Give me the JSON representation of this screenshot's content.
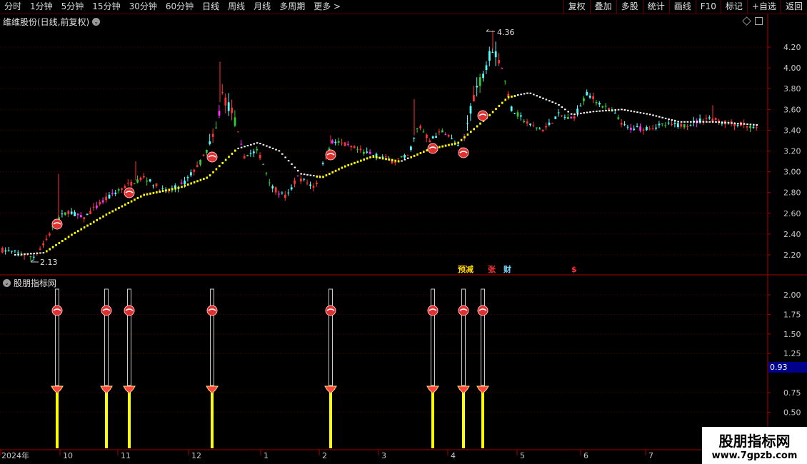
{
  "toolbar": {
    "tabs": [
      "分时",
      "1分钟",
      "5分钟",
      "15分钟",
      "30分钟",
      "60分钟",
      "日线",
      "周线",
      "月线",
      "多周期"
    ],
    "active_tab": "日线",
    "more_label": "更多 >",
    "right_buttons": [
      "复权",
      "叠加",
      "多股",
      "统计",
      "画线",
      "F10",
      "标记",
      "+自选",
      "返回"
    ]
  },
  "stock": {
    "title": "维维股份(日线,前复权)"
  },
  "indicator": {
    "title": "股朋指标网"
  },
  "price_axis": {
    "ticks": [
      "4.20",
      "4.00",
      "3.80",
      "3.60",
      "3.40",
      "3.20",
      "3.00",
      "2.80",
      "2.60",
      "2.40",
      "2.20"
    ]
  },
  "ind_axis": {
    "ticks": [
      "2.00",
      "1.75",
      "1.50",
      "1.25",
      "0.75",
      "0.50"
    ],
    "current": "0.93"
  },
  "annotations": {
    "high": "4.36",
    "low": "2.13"
  },
  "events": {
    "items": [
      "预减",
      "张",
      "财",
      "$"
    ]
  },
  "time_axis": {
    "labels": [
      "2024年",
      "10",
      "11",
      "12",
      "1",
      "2",
      "3",
      "4",
      "5",
      "6",
      "7"
    ]
  },
  "watermark": {
    "line1": "股朋指标网",
    "line2": "www.7gpzb.com"
  },
  "colors": {
    "up": "#ff3333",
    "down": "#54ffff",
    "ma_up": "#ffff00",
    "ma": "#ffffff",
    "green": "#33cc33",
    "magenta": "#ff33ff",
    "grid": "#5a0000"
  }
}
